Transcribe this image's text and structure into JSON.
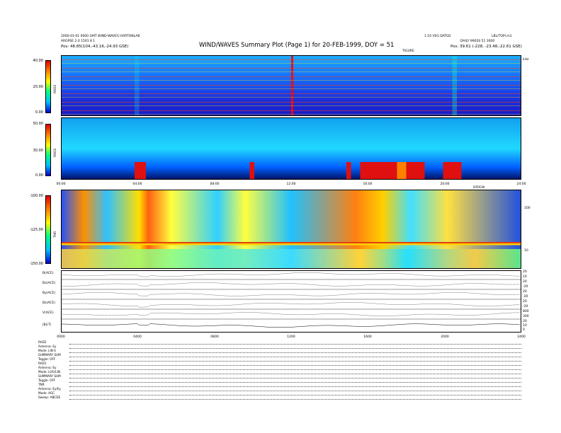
{
  "header": {
    "left_line1": "2000-01-01 0000 GMT  WIND-WAVES HORTONLAB",
    "left_line2": "ARGPSE 2.0 1501 8 1",
    "left_line3": "Pos:    48.85(104,-43.16,-24.93 GSE)",
    "title": "WIND/WAVES Summary Plot (Page 1) for 20-FEB-1999, DOY = 51",
    "right_line1": "1.10 VEG DATED",
    "right_line2": "LBL/TOPI.m1",
    "right_line3": "DAILY 99020 51 3000",
    "right_line4": "Pos:    39.61 (-228, -23.48,-22.61 GSE)",
    "top_axis_label": "TIGURE"
  },
  "chart_data": [
    {
      "type": "heatmap",
      "panel": "RAD2",
      "ylabel": "RAD2",
      "colorbar_ticks": [
        "40.00",
        "20.00",
        "0.00"
      ],
      "unit_label": "kHz"
    },
    {
      "type": "heatmap",
      "panel": "RAD1",
      "ylabel": "RAD1",
      "colorbar_ticks": [
        "50.00",
        "30.00",
        "0.00"
      ],
      "time_ticks": [
        "00:00",
        "04:00",
        "08:00",
        "12:00",
        "16:00",
        "20:00",
        "24:00"
      ]
    },
    {
      "type": "heatmap",
      "panel": "TNR",
      "ylabel": "TNR",
      "colorbar_ticks": [
        "-100.00",
        "-125.00",
        "-150.00"
      ],
      "right_ticks": [
        "100",
        "10"
      ],
      "time_label": "DFRGN"
    },
    {
      "type": "line",
      "panel": "magnetometer",
      "series": [
        {
          "name": "B(ACE)",
          "right_ticks": [
            "20",
            "10"
          ]
        },
        {
          "name": "Bx(ACE)",
          "right_ticks": [
            "20",
            "-20"
          ]
        },
        {
          "name": "By(ACE)",
          "right_ticks": [
            "20",
            "-20"
          ]
        },
        {
          "name": "Bz(ACE)",
          "right_ticks": [
            "20",
            "-20"
          ]
        },
        {
          "name": "V(ACE)",
          "right_ticks": [
            "800",
            "300"
          ]
        },
        {
          "name": "|B|(T)",
          "right_ticks": [
            "20",
            "10",
            "0"
          ]
        }
      ],
      "time_ticks": [
        "0000",
        "0400",
        "0800",
        "1200",
        "1600",
        "2000",
        "2400"
      ]
    }
  ],
  "settings": [
    "RAD2",
    "Antenna:       Ey",
    "Mode:      LIN S",
    "SUMMARY SUM",
    "Toggle:      OFF",
    "RAD1",
    "Antenna:       Ey",
    "Mode:    LOG/LIN",
    "SUMMARY SUM",
    "Toggle:      OFF",
    "TNR",
    "Antenna:   Ey/Ey",
    "Mode:       AGC",
    "Sweep:  ABCDE"
  ],
  "colors": {
    "background_low": "#1a1ad6",
    "background_mid": "#00a8ff",
    "burst": "#e01010",
    "high": "#ffff00"
  }
}
